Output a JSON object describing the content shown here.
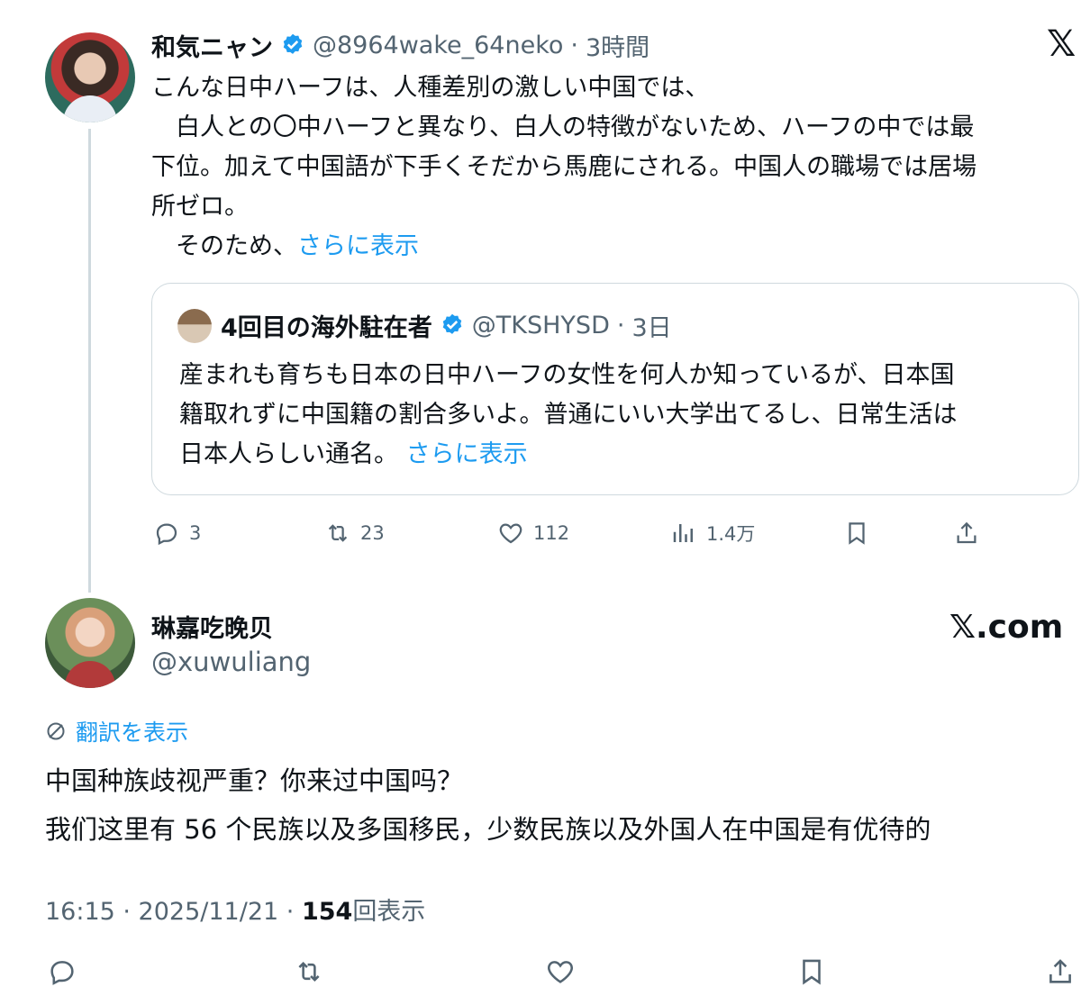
{
  "tweet1": {
    "display_name": "和気ニャン",
    "handle": "@8964wake_64neko",
    "time": "3時間",
    "lines": [
      "こんな日中ハーフは、人種差別の激しい中国では、",
      "　白人との〇中ハーフと異なり、白人の特徴がないため、ハーフの中では最",
      "下位。加えて中国語が下手くそだから馬鹿にされる。中国人の職場では居場",
      "所ゼロ。",
      "　そのため、"
    ],
    "show_more": "さらに表示",
    "stats": {
      "replies": "3",
      "reposts": "23",
      "likes": "112",
      "views": "1.4万"
    }
  },
  "quote": {
    "display_name": "4回目の海外駐在者",
    "handle": "@TKSHYSD",
    "time": "3日",
    "lines": [
      "産まれも育ちも日本の日中ハーフの女性を何人か知っているが、日本国",
      "籍取れずに中国籍の割合多いよ。普通にいい大学出てるし、日常生活は",
      "日本人らしい通名。"
    ],
    "show_more": "さらに表示"
  },
  "tweet2": {
    "display_name": "琳嘉吃晚贝",
    "handle": "@xuwuliang",
    "translate": "翻訳を表示",
    "lines": [
      "中国种族歧视严重？你来过中国吗？",
      "我们这里有 56 个民族以及多国移民，少数民族以及外国人在中国是有优待的"
    ],
    "timestamp": "16:15 · 2025/11/21 · ",
    "views_count": "154",
    "views_label": "回表示"
  },
  "brand": {
    "x_logo": "𝕏",
    "x_com": "𝕏.com"
  },
  "colors": {
    "link": "#1d9bf0",
    "verified": "#1d9bf0",
    "secondary_text": "#536471",
    "border": "#cfd9de"
  },
  "icons": [
    "verified-icon",
    "reply-icon",
    "repost-icon",
    "like-icon",
    "views-icon",
    "bookmark-icon",
    "share-icon",
    "translate-icon",
    "x-logo-icon"
  ]
}
